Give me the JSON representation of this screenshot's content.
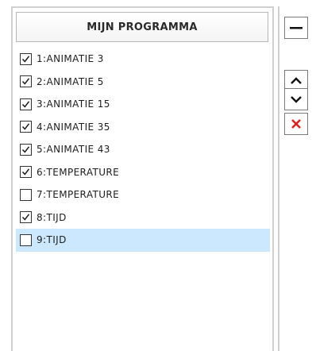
{
  "program_list": {
    "title": "MIJN PROGRAMMA",
    "items": [
      {
        "label": "1:ANIMATIE 3",
        "checked": true,
        "selected": false
      },
      {
        "label": "2:ANIMATIE 5",
        "checked": true,
        "selected": false
      },
      {
        "label": "3:ANIMATIE 15",
        "checked": true,
        "selected": false
      },
      {
        "label": "4:ANIMATIE 35",
        "checked": true,
        "selected": false
      },
      {
        "label": "5:ANIMATIE 43",
        "checked": true,
        "selected": false
      },
      {
        "label": "6:TEMPERATURE",
        "checked": true,
        "selected": false
      },
      {
        "label": "7:TEMPERATURE",
        "checked": false,
        "selected": false
      },
      {
        "label": "8:TIJD",
        "checked": true,
        "selected": false
      },
      {
        "label": "9:TIJD",
        "checked": false,
        "selected": true
      }
    ]
  },
  "side_buttons": {
    "minus_icon": "minus-icon",
    "up_icon": "chevron-up-icon",
    "down_icon": "chevron-down-icon",
    "delete_icon": "close-icon"
  },
  "colors": {
    "selection": "#cce8ff",
    "delete": "#e02020"
  }
}
